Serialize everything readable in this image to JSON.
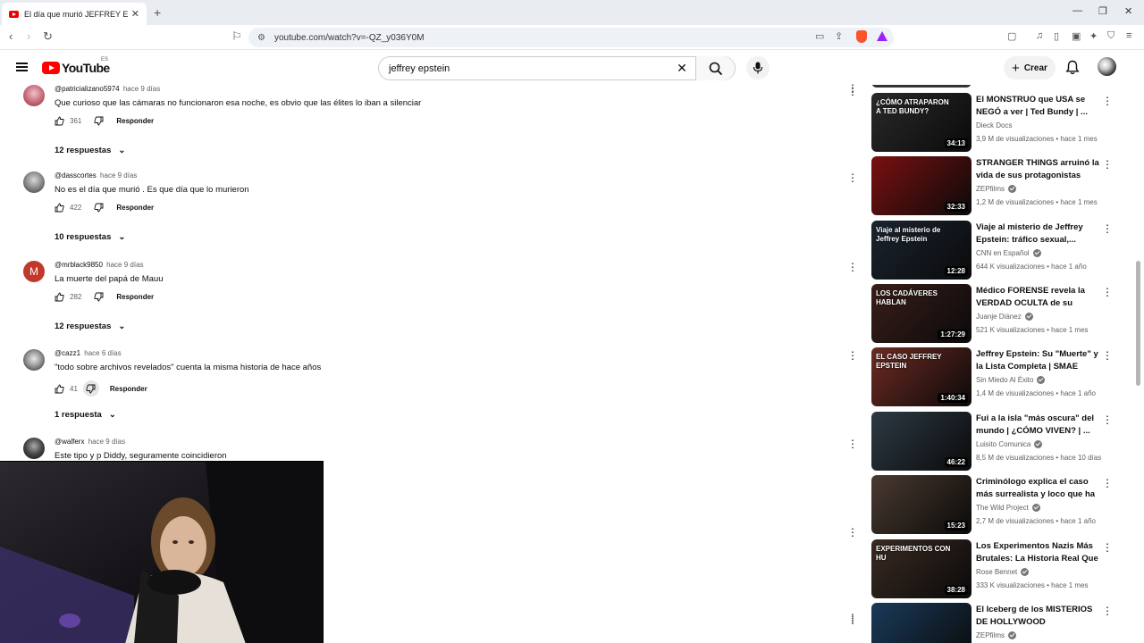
{
  "browser": {
    "tab_title": "El día que murió JEFFREY EPSTEIN",
    "url": "youtube.com/watch?v=-QZ_y036Y0M",
    "brave_badge": "9+"
  },
  "youtube": {
    "logo_text": "YouTube",
    "country_code": "ES",
    "search_query": "jeffrey epstein",
    "create_label": "Crear"
  },
  "comments": [
    {
      "author": "@patricializano5974",
      "time": "hace 9 días",
      "text": "Que curioso que las cámaras no funcionaron esa noche, es obvio que las élites lo iban a silenciar",
      "likes": "361",
      "reply_label": "Responder",
      "replies": "12 respuestas"
    },
    {
      "author": "@dasscortes",
      "time": "hace 9 días",
      "text": "No es el día que murió . Es que día que lo murieron",
      "likes": "422",
      "reply_label": "Responder",
      "replies": "10 respuestas"
    },
    {
      "author": "@mrblack9850",
      "time": "hace 9 días",
      "text": "La muerte del papá de Mauu",
      "likes": "282",
      "reply_label": "Responder",
      "replies": "12 respuestas",
      "avatar_letter": "M"
    },
    {
      "author": "@cazz1",
      "time": "hace 6 días",
      "text": "\"todo sobre archivos revelados\" cuenta la misma historia de hace años",
      "likes": "41",
      "reply_label": "Responder",
      "replies": "1 respuesta"
    },
    {
      "author": "@walferx",
      "time": "hace 9 días",
      "text": "Este tipo y p Diddy, seguramente coincidieron"
    }
  ],
  "related": [
    {
      "title": "El MONSTRUO que USA se NEGÓ a ver | Ted Bundy | ...",
      "channel": "Dieck Docs",
      "verified": false,
      "meta": "3,9 M de visualizaciones • hace 1 mes",
      "duration": "34:13",
      "thumb_text": "¿CÓMO ATRAPARON A TED BUNDY?",
      "color": "#2a2a2a"
    },
    {
      "title": "STRANGER THINGS arruinó la vida de sus protagonistas",
      "channel": "ZEPfilms",
      "verified": true,
      "meta": "1,2 M de visualizaciones • hace 1 mes",
      "duration": "32:33",
      "thumb_text": "",
      "color": "#7a1010"
    },
    {
      "title": "Viaje al misterio de Jeffrey Epstein: tráfico sexual,...",
      "channel": "CNN en Español",
      "verified": true,
      "meta": "644 K visualizaciones • hace 1 año",
      "duration": "12:28",
      "thumb_text": "Viaje al misterio de Jeffrey Epstein",
      "color": "#1b2430"
    },
    {
      "title": "Médico FORENSE revela la VERDAD OCULTA de su trabajo",
      "channel": "Juanje Diánez",
      "verified": true,
      "meta": "521 K visualizaciones • hace 1 mes",
      "duration": "1:27:29",
      "thumb_text": "LOS CADÁVERES HABLAN",
      "color": "#3a1e1a"
    },
    {
      "title": "Jeffrey Epstein: Su \"Muerte\" y la Lista Completa | SMAE Podca...",
      "channel": "Sin Miedo Al Éxito",
      "verified": true,
      "meta": "1,4 M de visualizaciones • hace 1 año",
      "duration": "1:40:34",
      "thumb_text": "EL CASO JEFFREY EPSTEIN",
      "color": "#6e2a22"
    },
    {
      "title": "Fui a la isla \"más oscura\" del mundo | ¿CÓMO VIVEN? | ...",
      "channel": "Luisito Comunica",
      "verified": true,
      "meta": "8,5 M de visualizaciones • hace 10 días",
      "duration": "46:22",
      "thumb_text": "",
      "color": "#2d3a44"
    },
    {
      "title": "Criminólogo explica el caso más surrealista y loco que ha ...",
      "channel": "The Wild Project",
      "verified": true,
      "meta": "2,7 M de visualizaciones • hace 1 año",
      "duration": "15:23",
      "thumb_text": "",
      "color": "#4a3a30"
    },
    {
      "title": "Los Experimentos Nazis Más Brutales: La Historia Real Que ...",
      "channel": "Rose Bennet",
      "verified": true,
      "meta": "333 K visualizaciones • hace 1 mes",
      "duration": "38:28",
      "thumb_text": "EXPERIMENTOS CON HU",
      "color": "#3a2a22"
    },
    {
      "title": "El Iceberg de los MISTERIOS DE HOLLYWOOD",
      "channel": "ZEPfilms",
      "verified": true,
      "meta": "",
      "duration": "",
      "thumb_text": "",
      "color": "#1a3a5a"
    }
  ]
}
